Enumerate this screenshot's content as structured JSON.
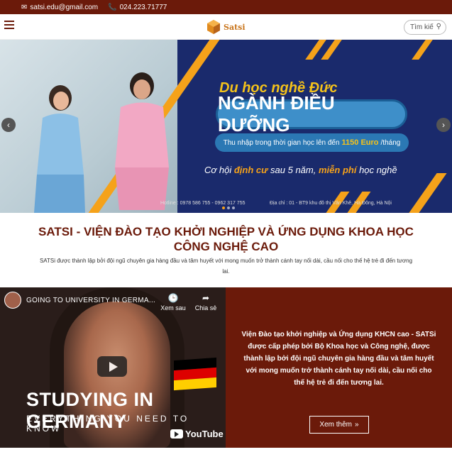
{
  "topbar": {
    "email": "satsi.edu@gmail.com",
    "phone": "024.223.71777",
    "email_icon": "mail-icon",
    "phone_icon": "phone-icon"
  },
  "header": {
    "logo_text": "Satsi",
    "search_placeholder": "Tìm kiế",
    "menu_icon": "hamburger-icon",
    "search_icon": "search-icon"
  },
  "hero": {
    "title_line1": "Du học nghề Đức",
    "title_main": "NGÀNH ĐIỀU DƯỠNG",
    "income_prefix": "Thu nhập trong thời gian học lên đến",
    "income_value": "1150 Euro",
    "income_suffix": "/tháng",
    "chance_prefix": "Cơ hội",
    "chance_highlight1": "định cư",
    "chance_mid": "sau 5 năm,",
    "chance_highlight2": "miễn phí",
    "chance_suffix": "học nghề",
    "hotline": "Hotline : 0978 586 755 - 0962 317 755",
    "address": "Địa chỉ : 01 - BT9 khu đô thị Văn Khê, Hà Đông, Hà Nội",
    "prev_icon": "chevron-left-icon",
    "next_icon": "chevron-right-icon"
  },
  "intro": {
    "title": "SATSI - VIỆN ĐÀO TẠO KHỞI NGHIỆP VÀ ỨNG DỤNG KHOA HỌC CÔNG NGHỆ CAO",
    "text": "SATSi được thành lập bởi đội ngũ chuyên gia hàng đầu và tâm huyết với mong muốn trở thành cánh tay nối dài, cầu nối cho thế hệ trẻ đi đến tương lai."
  },
  "video": {
    "title": "GOING TO UNIVERSITY IN GERMA...",
    "watch_later": "Xem sau",
    "share": "Chia sẻ",
    "big_text": "STUDYING IN GERMANY",
    "sub_text": "EVERYTHING YOU NEED TO KNOW",
    "brand": "YouTube",
    "flag_colors": [
      "#000000",
      "#dd0000",
      "#ffce00"
    ]
  },
  "panel": {
    "text": "Viện Đào tạo khởi nghiệp và Ứng dụng KHCN cao - SATSi được cấp phép bởi Bộ Khoa học và Công nghệ, được thành lập bởi đội ngũ chuyên gia hàng đầu và tâm huyết với mong muốn trở thành cánh tay nối dài, cầu nối cho thế hệ trẻ đi đến tương lai.",
    "button": "Xem thêm",
    "button_icon": "double-chevron-right-icon"
  }
}
